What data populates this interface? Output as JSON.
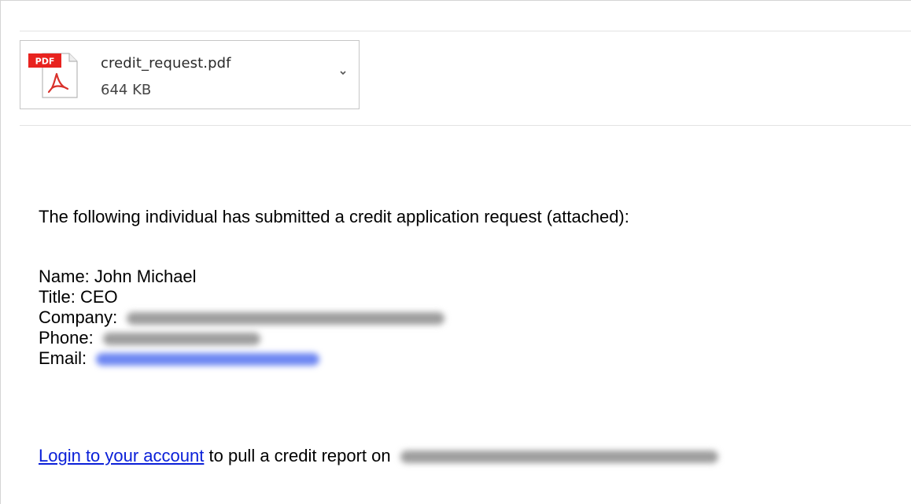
{
  "attachment": {
    "icon": "pdf-file-icon",
    "icon_badge": "PDF",
    "filename": "credit_request.pdf",
    "size": "644 KB",
    "menu_icon": "chevron-down-icon"
  },
  "message": {
    "intro": "The following individual has submitted a credit application request (attached):",
    "fields": [
      {
        "label": "Name:",
        "value": "John Michael"
      },
      {
        "label": "Title:",
        "value": "CEO"
      },
      {
        "label": "Company:",
        "value": ""
      },
      {
        "label": "Phone:",
        "value": ""
      },
      {
        "label": "Email:",
        "value": ""
      }
    ],
    "login_link": "Login to your account",
    "login_suffix": "to pull a credit report on"
  },
  "colors": {
    "link": "#0b20d8",
    "pdf_badge": "#e8231f",
    "redaction_gray": "#9d9d9d",
    "redaction_blue": "#6d86f2"
  }
}
